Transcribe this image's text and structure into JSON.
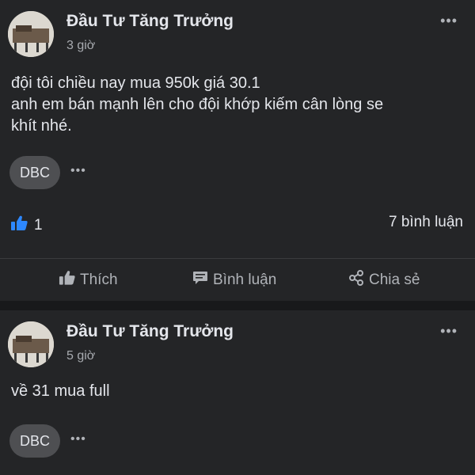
{
  "posts": [
    {
      "author": "Đầu Tư Tăng Trưởng",
      "time": "3 giờ",
      "lines": [
        "đội tôi chiều nay mua 950k giá 30.1",
        "anh em bán mạnh lên cho đội khớp kiếm cân lòng se",
        "khít nhé."
      ],
      "tag": "DBC",
      "more": "•••",
      "likes": "1",
      "comments": "7 bình luận",
      "actions": {
        "like": "Thích",
        "comment": "Bình luận",
        "share": "Chia sẻ"
      }
    },
    {
      "author": "Đầu Tư Tăng Trưởng",
      "time": "5 giờ",
      "lines": [
        "về 31 mua full"
      ],
      "tag": "DBC",
      "more": "•••"
    }
  ],
  "colors": {
    "background": "#18191b",
    "card": "#242527",
    "text": "#e4e6eb",
    "muted": "#b0b3b8",
    "like_blue": "#2d88ff",
    "tag_bg": "#4e4f52"
  },
  "icons": [
    "like-icon",
    "thumb-up-icon",
    "comment-icon",
    "share-icon",
    "more-icon"
  ]
}
